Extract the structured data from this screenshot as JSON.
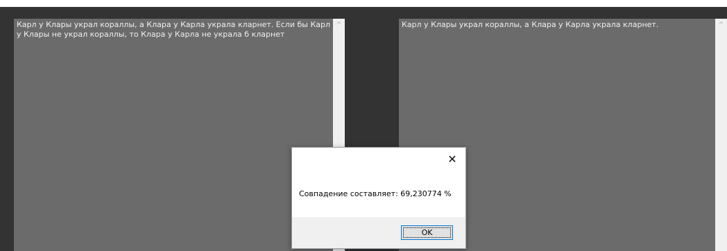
{
  "text_left": "Карл у Клары украл кораллы, а Клара у Карла украла кларнет. Если бы Карл у Клары не украл кораллы, то Клара у Карла не украла б кларнет",
  "text_right": "Карл у Клары украл кораллы, а Клара у Карла украла кларнет.",
  "dialog": {
    "message": "Совпадение составляет: 69,230774 %",
    "ok_label": "OK",
    "close_glyph": "✕"
  },
  "scrollbar": {
    "up_arrow_glyph": "^"
  },
  "colors": {
    "background": "#333333",
    "textarea": "#6b6b6b",
    "text": "#f0f0f0",
    "dialog_button_border": "#0078d7"
  }
}
